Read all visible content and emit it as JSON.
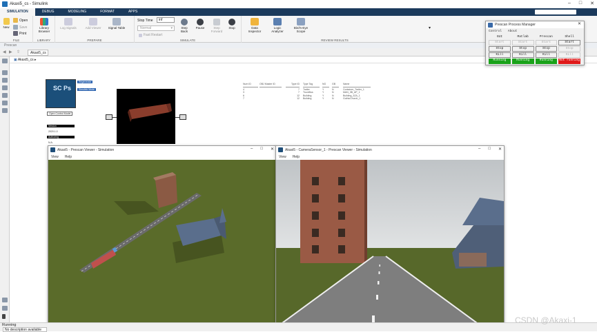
{
  "window": {
    "title": "Akaxi5_cs - Simulink"
  },
  "ribbon": {
    "tabs": [
      "SIMULATION",
      "DEBUG",
      "MODELING",
      "FORMAT",
      "APPS"
    ],
    "groups": {
      "file": "FILE",
      "library": "LIBRARY",
      "prepare": "PREPARE",
      "simulate": "SIMULATE",
      "review": "REVIEW RESULTS"
    },
    "file_items": {
      "new": "New",
      "open": "Open",
      "save": "Save",
      "print": "Print"
    },
    "library_browser": "Library Browser",
    "log_signals": "Log Signals",
    "add_viewer": "Add Viewer",
    "signal_table": "Signal Table",
    "stop_time_label": "Stop Time",
    "stop_time_value": "inf",
    "mode_value": "Normal",
    "fast_restart": "Fast Restart",
    "step_back": "Step Back",
    "pause": "Pause",
    "step_forward": "Step Forward",
    "stop": "Stop",
    "data_inspector": "Data Inspector",
    "logic_analyzer": "Logic Analyzer",
    "birds_eye": "Bird's-Eye Scope"
  },
  "breadcrumb_strip": "Prescan",
  "model_tab": "Akaxi5_cs",
  "model_path": "Akaxi5_cs",
  "blocks": {
    "ps_logo": "SC Ps",
    "tag_regenerate": "Regenerate",
    "tag_simulate": "Simulink Mode",
    "open_label": "Open Control Model",
    "label_a": "Version",
    "label_b": "2020.1.0",
    "label_c": "Authoring",
    "label_d": "N.A."
  },
  "obj_table": {
    "headers": [
      "Num ID",
      "OBJ Master ID",
      "Type ID",
      "Type Tag",
      "NG",
      "GB",
      "Name"
    ],
    "rows": [
      [
        "4",
        "",
        "7",
        "Trailer",
        "Y",
        "N",
        "Container_Trailer_1"
      ],
      [
        "3",
        "",
        "7",
        "TruckBus",
        "Y",
        "N",
        "MAN_3B_AP_1"
      ],
      [
        "6",
        "",
        "12",
        "Building",
        "Y",
        "N",
        "Building_3ZA_1"
      ],
      [
        "7",
        "",
        "12",
        "Building",
        "Y",
        "N",
        "GothicChurch_1"
      ]
    ]
  },
  "ppm": {
    "title": "Prescan Process Manager",
    "menu": [
      "Control",
      "About"
    ],
    "columns": [
      "GUI",
      "Matlab",
      "Prescan",
      "Shell"
    ],
    "start_row": [
      "Start",
      "Start",
      "Start",
      "Start"
    ],
    "stop_row": [
      "Stop",
      "Stop",
      "Stop",
      "Stop"
    ],
    "kill_row": [
      "Kill",
      "Kill",
      "Kill",
      "Kill"
    ],
    "status_row": [
      "Running",
      "Running",
      "Running",
      "Not running"
    ],
    "colors": {
      "running": "#1aa21a",
      "not_running": "#e01a1a"
    }
  },
  "viewer1": {
    "title": "Akaxi5 - Prescan Viewer - Simulation",
    "menu": [
      "View",
      "Help"
    ]
  },
  "viewer2": {
    "title": "Akaxi5 - CameraSensor_1 - Prescan Viewer - Simulation",
    "menu": [
      "View",
      "Help"
    ]
  },
  "status": {
    "running": "Running",
    "desc": "No description available"
  },
  "watermark": "CSDN @Akaxi-1"
}
